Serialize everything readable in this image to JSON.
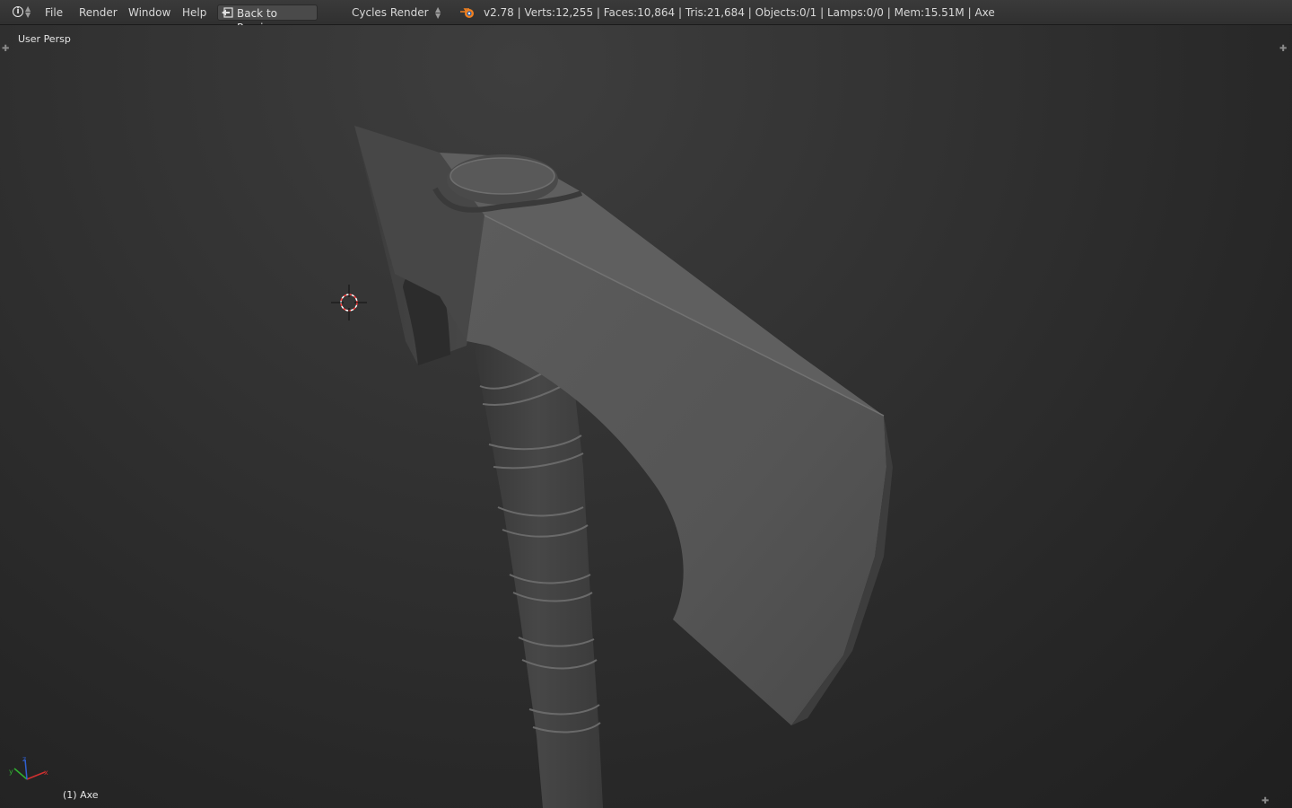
{
  "menubar": {
    "info_icon": "info-icon",
    "file_label": "File",
    "render_label": "Render",
    "window_label": "Window",
    "help_label": "Help",
    "back_label": "Back to Previous",
    "engine_value": "Cycles Render",
    "stats": "v2.78 | Verts:12,255 | Faces:10,864 | Tris:21,684 | Objects:0/1 | Lamps:0/0 | Mem:15.51M | Axe"
  },
  "viewport": {
    "view_label": "User Persp",
    "object_label": "(1) Axe",
    "axis_labels": {
      "x": "x",
      "y": "y",
      "z": "z"
    }
  },
  "colors": {
    "header": "#333333",
    "viewport_bg": "#2b2b2b",
    "model": "#545454",
    "axis_x": "#d03030",
    "axis_y": "#30b030",
    "axis_z": "#3060d0"
  }
}
